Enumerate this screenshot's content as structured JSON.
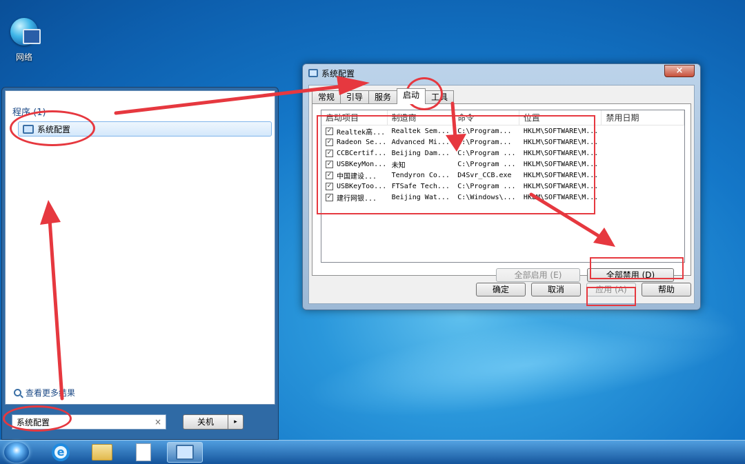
{
  "desktop": {
    "network_icon": {
      "icon": "network-globe-icon",
      "label": "网络"
    }
  },
  "start_menu": {
    "programs_heading": "程序 (1)",
    "result_item": "系统配置",
    "see_more": "查看更多结果",
    "search": {
      "value": "系统配置",
      "clear": "×"
    },
    "shutdown_label": "关机",
    "shutdown_arrow": "▸"
  },
  "taskbar": {
    "items": [
      "start-orb-icon",
      "internet-explorer-icon",
      "file-explorer-icon",
      "document-icon",
      "msconfig-icon"
    ],
    "ie_glyph": "e"
  },
  "dialog": {
    "title": "系统配置",
    "close": "×",
    "tabs": [
      "常规",
      "引导",
      "服务",
      "启动",
      "工具"
    ],
    "active_tab": "启动",
    "columns": [
      "启动项目",
      "制造商",
      "命令",
      "位置",
      "禁用日期"
    ],
    "rows": [
      {
        "item": "Realtek高...",
        "maker": "Realtek Sem...",
        "command": "C:\\Program...",
        "location": "HKLM\\SOFTWARE\\M...",
        "checked": "✓"
      },
      {
        "item": "Radeon Se...",
        "maker": "Advanced Mi...",
        "command": "C:\\Program...",
        "location": "HKLM\\SOFTWARE\\M...",
        "checked": "✓"
      },
      {
        "item": "CCBCertif...",
        "maker": "Beijing Dam...",
        "command": "C:\\Program ...",
        "location": "HKLM\\SOFTWARE\\M...",
        "checked": "✓"
      },
      {
        "item": "USBKeyMon...",
        "maker": "未知",
        "command": "C:\\Program ...",
        "location": "HKLM\\SOFTWARE\\M...",
        "checked": "✓"
      },
      {
        "item": "中国建设...",
        "maker": "Tendyron Co...",
        "command": "D4Svr_CCB.exe",
        "location": "HKLM\\SOFTWARE\\M...",
        "checked": "✓"
      },
      {
        "item": "USBKeyToo...",
        "maker": "FTSafe Tech...",
        "command": "C:\\Program ...",
        "location": "HKLM\\SOFTWARE\\M...",
        "checked": "✓"
      },
      {
        "item": "建行网银...",
        "maker": "Beijing Wat...",
        "command": "C:\\Windows\\...",
        "location": "HKLM\\SOFTWARE\\M...",
        "checked": "✓"
      }
    ],
    "enable_all": "全部启用 (E)",
    "disable_all": "全部禁用 (D)",
    "ok": "确定",
    "cancel": "取消",
    "apply": "应用 (A)",
    "help": "帮助"
  },
  "annotation_color": "#e6383f"
}
